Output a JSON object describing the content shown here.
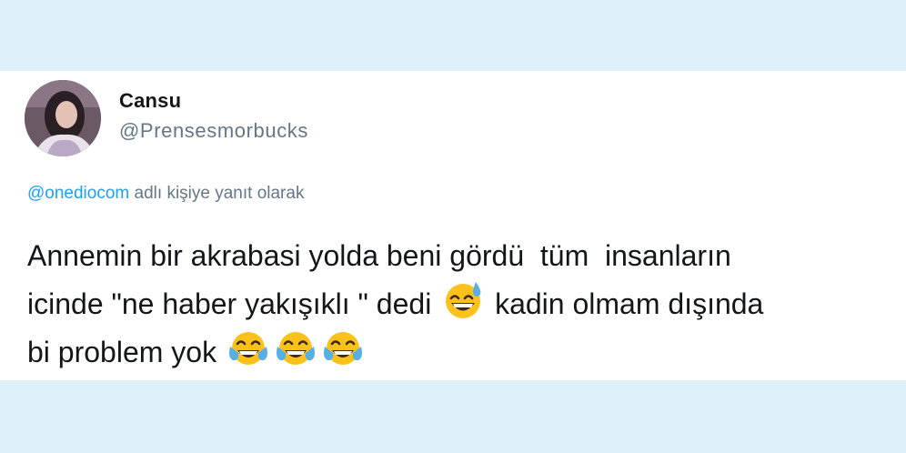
{
  "tweet": {
    "author": {
      "display_name": "Cansu",
      "handle": "@Prensesmorbucks"
    },
    "reply_to": {
      "mention": "@onediocom",
      "suffix": " adlı kişiye yanıt olarak"
    },
    "text": {
      "line1": "Annemin bir akrabasi yolda beni gördü  tüm  insanların",
      "line2_before_emoji": "icinde \"ne haber yakışıklı \" dedi ",
      "line2_after_emoji": " kadin olmam dışında",
      "line3": "bi problem yok "
    },
    "emojis": {
      "sweat_smile": "grinning-face-with-sweat-icon",
      "joy": "face-with-tears-of-joy-icon"
    }
  },
  "colors": {
    "background": "#def1fa",
    "card": "#ffffff",
    "text": "#14171a",
    "muted": "#657786",
    "link": "#1da1f2"
  }
}
